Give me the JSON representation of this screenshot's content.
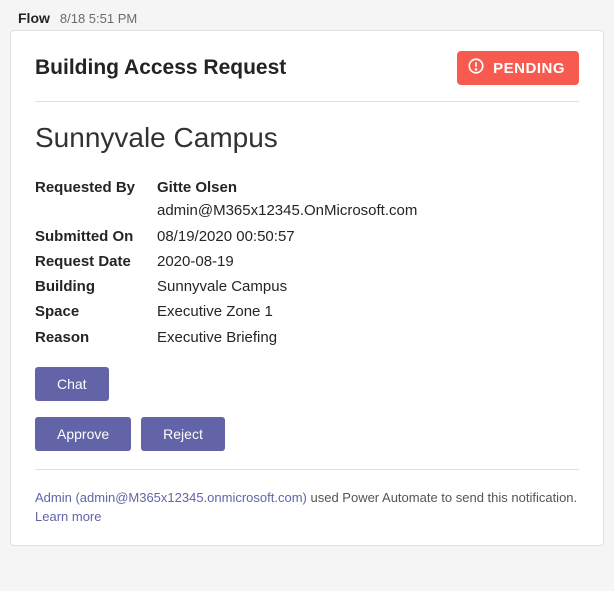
{
  "header": {
    "sender": "Flow",
    "timestamp": "8/18 5:51 PM"
  },
  "card": {
    "title": "Building Access Request",
    "status": "PENDING",
    "campus": "Sunnyvale Campus",
    "details": {
      "requested_by_label": "Requested By",
      "requested_by_name": "Gitte Olsen",
      "requested_by_email": "admin@M365x12345.OnMicrosoft.com",
      "submitted_on_label": "Submitted On",
      "submitted_on_value": "08/19/2020 00:50:57",
      "request_date_label": "Request Date",
      "request_date_value": "2020-08-19",
      "building_label": "Building",
      "building_value": "Sunnyvale Campus",
      "space_label": "Space",
      "space_value": "Executive Zone 1",
      "reason_label": "Reason",
      "reason_value": "Executive Briefing"
    },
    "buttons": {
      "chat": "Chat",
      "approve": "Approve",
      "reject": "Reject"
    },
    "footer": {
      "admin_link": "Admin (admin@M365x12345.onmicrosoft.com)",
      "tail": " used Power Automate to send this notification. ",
      "learn_more": "Learn more"
    }
  }
}
